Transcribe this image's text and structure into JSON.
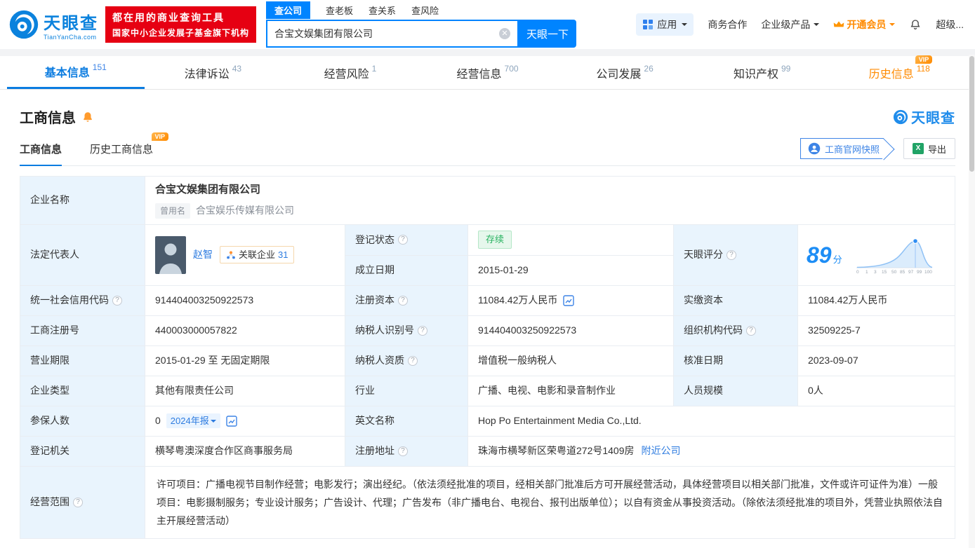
{
  "header": {
    "logo": {
      "name": "天眼查",
      "domain": "TianYanCha.com"
    },
    "promo": {
      "line1": "都在用的商业查询工具",
      "line2": "国家中小企业发展子基金旗下机构"
    },
    "search": {
      "tabs": {
        "company": "查公司",
        "boss": "查老板",
        "relation": "查关系",
        "risk": "查风险"
      },
      "value": "合宝文娱集团有限公司",
      "button": "天眼一下"
    },
    "nav": {
      "apps": "应用",
      "cooperation": "商务合作",
      "enterprise": "企业级产品",
      "vip": "开通会员",
      "super": "超级..."
    }
  },
  "tabs": {
    "basic": {
      "label": "基本信息",
      "count": "151"
    },
    "legal": {
      "label": "法律诉讼",
      "count": "43"
    },
    "risk": {
      "label": "经营风险",
      "count": "1"
    },
    "operation": {
      "label": "经营信息",
      "count": "700"
    },
    "development": {
      "label": "公司发展",
      "count": "26"
    },
    "ip": {
      "label": "知识产权",
      "count": "99"
    },
    "history": {
      "label": "历史信息",
      "count": "118",
      "vip": "VIP"
    }
  },
  "section": {
    "title": "工商信息",
    "brand": "天眼查",
    "subtab_current": "工商信息",
    "subtab_history": "历史工商信息",
    "vip": "VIP",
    "snapshot": "工商官网快照",
    "export": "导出"
  },
  "info": {
    "company_name": {
      "label": "企业名称",
      "value": "合宝文娱集团有限公司",
      "former_label": "曾用名",
      "former": "合宝娱乐传媒有限公司"
    },
    "legal_rep": {
      "label": "法定代表人",
      "name": "赵智",
      "related_label": "关联企业",
      "related_count": "31"
    },
    "reg_status": {
      "label": "登记状态",
      "value": "存续"
    },
    "establish_date": {
      "label": "成立日期",
      "value": "2015-01-29"
    },
    "score": {
      "label": "天眼评分",
      "value": "89",
      "unit": "分",
      "axis": [
        "0",
        "1",
        "3",
        "15",
        "50",
        "85",
        "97",
        "99",
        "100"
      ]
    },
    "credit_code": {
      "label": "统一社会信用代码",
      "value": "914404003250922573"
    },
    "reg_capital": {
      "label": "注册资本",
      "value": "11084.42万人民币"
    },
    "paid_capital": {
      "label": "实缴资本",
      "value": "11084.42万人民币"
    },
    "reg_number": {
      "label": "工商注册号",
      "value": "440003000057822"
    },
    "tax_number": {
      "label": "纳税人识别号",
      "value": "914404003250922573"
    },
    "org_code": {
      "label": "组织机构代码",
      "value": "32509225-7"
    },
    "business_term": {
      "label": "营业期限",
      "value": "2015-01-29 至 无固定期限"
    },
    "taxpayer_quality": {
      "label": "纳税人资质",
      "value": "增值税一般纳税人"
    },
    "approval_date": {
      "label": "核准日期",
      "value": "2023-09-07"
    },
    "company_type": {
      "label": "企业类型",
      "value": "其他有限责任公司"
    },
    "industry": {
      "label": "行业",
      "value": "广播、电视、电影和录音制作业"
    },
    "staff_size": {
      "label": "人员规模",
      "value": "0人"
    },
    "insured": {
      "label": "参保人数",
      "value": "0",
      "report": "2024年报"
    },
    "english_name": {
      "label": "英文名称",
      "value": "Hop Po Entertainment Media Co.,Ltd."
    },
    "reg_authority": {
      "label": "登记机关",
      "value": "横琴粤澳深度合作区商事服务局"
    },
    "reg_address": {
      "label": "注册地址",
      "value": "珠海市横琴新区荣粤道272号1409房",
      "nearby": "附近公司"
    },
    "business_scope": {
      "label": "经营范围",
      "value": "许可项目：广播电视节目制作经营；电影发行；演出经纪。（依法须经批准的项目，经相关部门批准后方可开展经营活动，具体经营项目以相关部门批准，文件或许可证件为准）一般项目：电影摄制服务；专业设计服务；广告设计、代理；广告发布（非广播电台、电视台、报刊出版单位）；以自有资金从事投资活动。（除依法须经批准的项目外，凭营业执照依法自主开展经营活动）"
    }
  }
}
